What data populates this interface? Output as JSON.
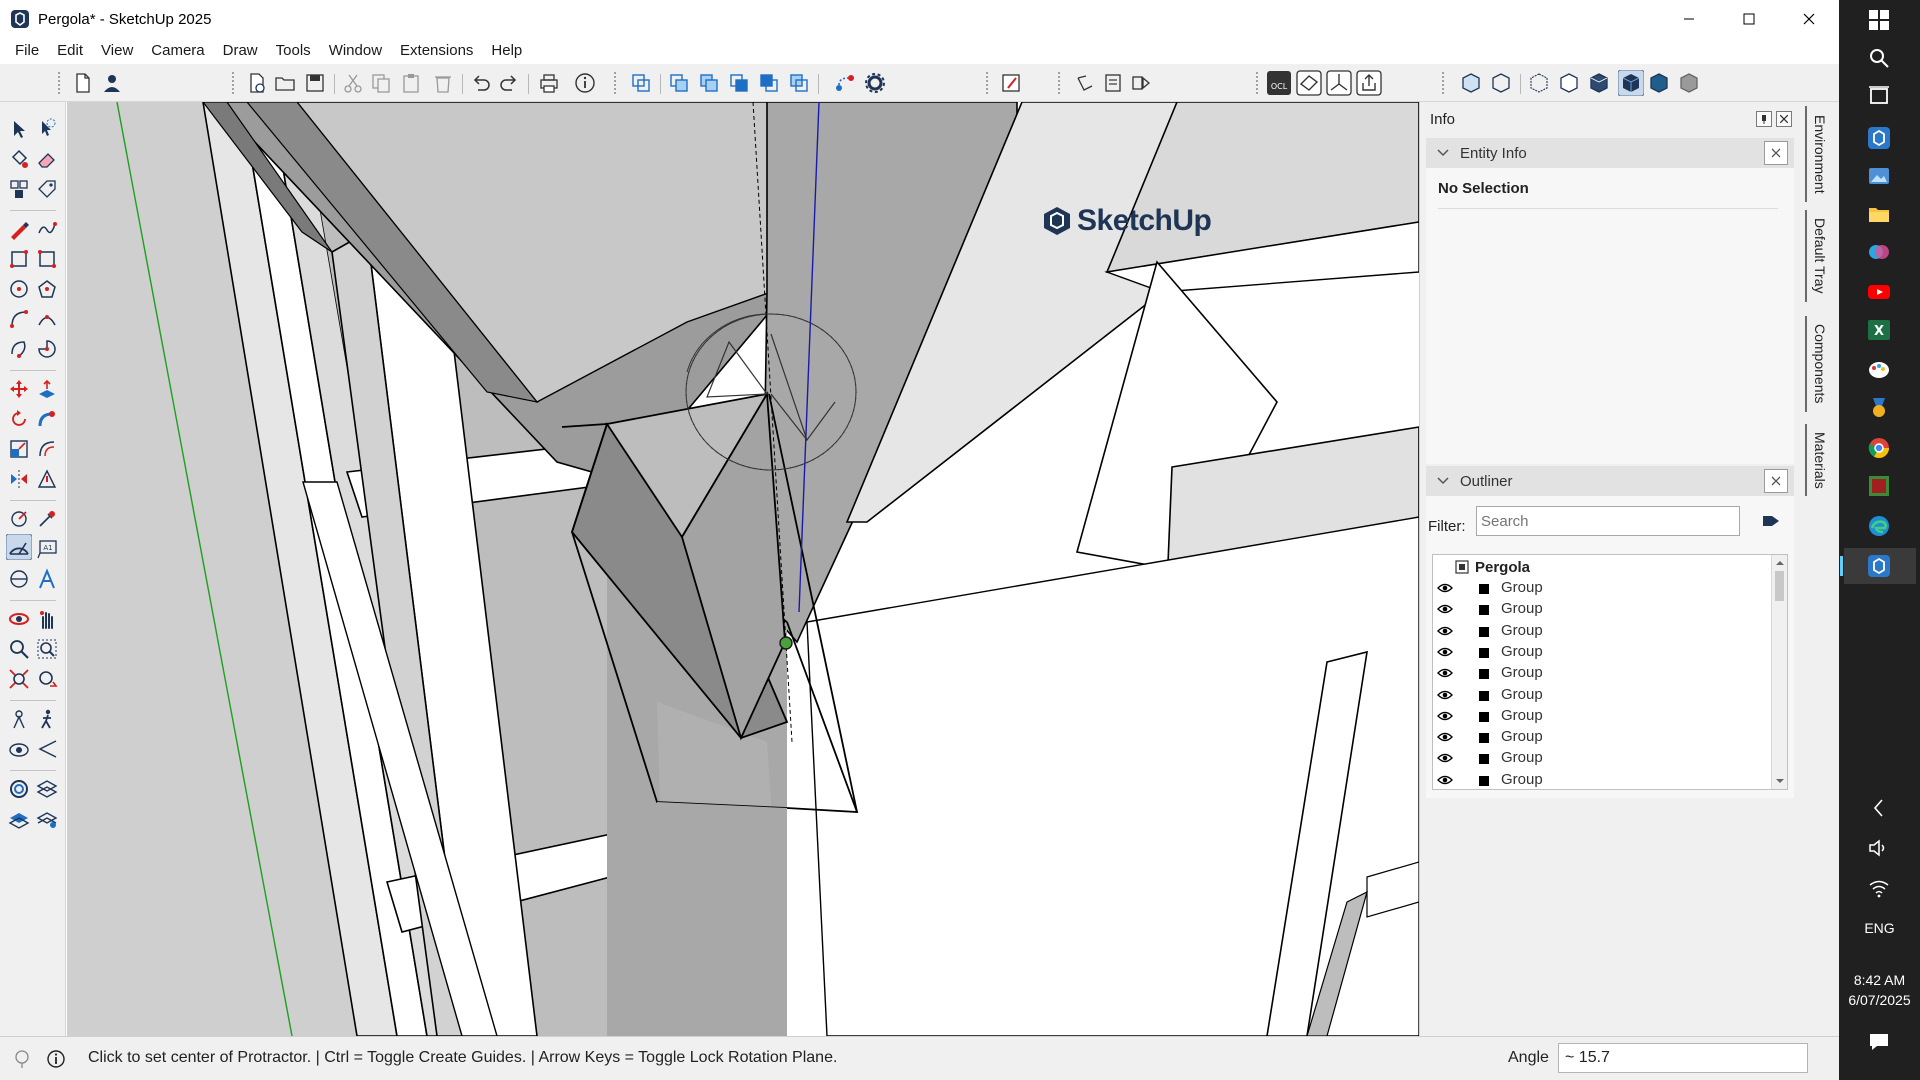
{
  "window": {
    "title": "Pergola* - SketchUp 2025",
    "minimize_icon": "minimize-icon",
    "maximize_icon": "maximize-icon",
    "close_icon": "close-icon"
  },
  "menu": [
    "File",
    "Edit",
    "View",
    "Camera",
    "Draw",
    "Tools",
    "Window",
    "Extensions",
    "Help"
  ],
  "viewport": {
    "watermark": "SketchUp"
  },
  "info_panel": {
    "title": "Info",
    "entity_info": {
      "header": "Entity Info",
      "selection_text": "No Selection"
    },
    "outliner": {
      "header": "Outliner",
      "filter_label": "Filter:",
      "filter_placeholder": "Search",
      "filter_value": "",
      "root_label": "Pergola",
      "rows": [
        "Group",
        "Group",
        "Group",
        "Group",
        "Group",
        "Group",
        "Group",
        "Group",
        "Group",
        "Group"
      ]
    }
  },
  "side_tabs": [
    "Environment",
    "Default Tray",
    "Components",
    "Materials"
  ],
  "status": {
    "hint": "Click to set center of Protractor. | Ctrl = Toggle Create Guides. | Arrow Keys = Toggle Lock Rotation Plane.",
    "measure_label": "Angle",
    "measure_value": "~ 15.7"
  },
  "taskbar": {
    "language": "ENG",
    "time": "8:42 AM",
    "date": "6/07/2025"
  },
  "colors": {
    "accent_blue": "#1e3556",
    "axis_blue": "#1a1aa8",
    "axis_green": "#1ea01e",
    "taskbar_bg": "#202020",
    "active_indicator": "#60cdff"
  }
}
